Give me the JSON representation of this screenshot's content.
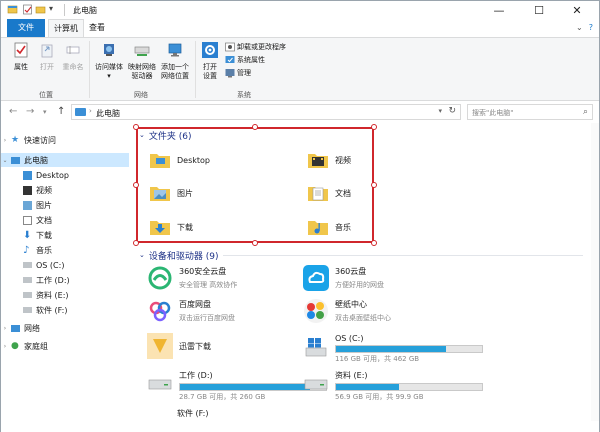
{
  "window": {
    "title": "此电脑",
    "controls": {
      "minimize": "—",
      "maximize": "☐",
      "close": "✕"
    }
  },
  "ribbon_tabs": {
    "file": "文件",
    "computer": "计算机",
    "view": "查看"
  },
  "ribbon": {
    "location": {
      "label": "位置",
      "properties": "属性",
      "open": "打开",
      "rename": "重命名"
    },
    "network": {
      "label": "网络",
      "access_media": "访问媒体",
      "map_drive_1": "映射网络",
      "map_drive_2": "驱动器",
      "add_location_1": "添加一个",
      "add_location_2": "网络位置"
    },
    "system": {
      "label": "系统",
      "open_settings_1": "打开",
      "open_settings_2": "设置",
      "uninstall": "卸载或更改程序",
      "sys_props": "系统属性",
      "manage": "管理"
    }
  },
  "address": {
    "breadcrumb": "此电脑",
    "search_placeholder": "搜索\"此电脑\""
  },
  "sidebar": {
    "items": [
      {
        "label": "快速访问",
        "icon": "star-icon"
      },
      {
        "label": "此电脑",
        "icon": "computer-icon"
      },
      {
        "label": "Desktop",
        "icon": "desktop-folder-icon"
      },
      {
        "label": "视频",
        "icon": "video-folder-icon"
      },
      {
        "label": "图片",
        "icon": "pictures-folder-icon"
      },
      {
        "label": "文档",
        "icon": "documents-folder-icon"
      },
      {
        "label": "下载",
        "icon": "download-icon"
      },
      {
        "label": "音乐",
        "icon": "music-icon"
      },
      {
        "label": "OS (C:)",
        "icon": "drive-icon"
      },
      {
        "label": "工作 (D:)",
        "icon": "drive-icon"
      },
      {
        "label": "资料 (E:)",
        "icon": "drive-icon"
      },
      {
        "label": "软件 (F:)",
        "icon": "drive-icon"
      },
      {
        "label": "网络",
        "icon": "network-icon"
      },
      {
        "label": "家庭组",
        "icon": "homegroup-icon"
      }
    ]
  },
  "folders": {
    "header": "文件夹 (6)",
    "items": [
      {
        "label": "Desktop"
      },
      {
        "label": "视频"
      },
      {
        "label": "图片"
      },
      {
        "label": "文档"
      },
      {
        "label": "下载"
      },
      {
        "label": "音乐"
      }
    ]
  },
  "devices": {
    "header": "设备和驱动器 (9)",
    "items": [
      {
        "name": "360安全云盘",
        "sub": "安全管理 高效协作",
        "fill": null
      },
      {
        "name": "360云盘",
        "sub": "方便好用的网盘",
        "fill": null
      },
      {
        "name": "百度网盘",
        "sub": "双击运行百度网盘",
        "fill": null
      },
      {
        "name": "壁纸中心",
        "sub": "双击桌面壁纸中心",
        "fill": null
      },
      {
        "name": "迅雷下载",
        "sub": "",
        "fill": null
      },
      {
        "name": "OS (C:)",
        "sub": "116 GB 可用，共 462 GB",
        "fill": 0.75
      },
      {
        "name": "工作 (D:)",
        "sub": "28.7 GB 可用，共 260 GB",
        "fill": 0.89
      },
      {
        "name": "资料 (E:)",
        "sub": "56.9 GB 可用，共 99.9 GB",
        "fill": 0.43
      },
      {
        "name": "软件 (F:)",
        "sub": "",
        "fill": null
      }
    ]
  }
}
